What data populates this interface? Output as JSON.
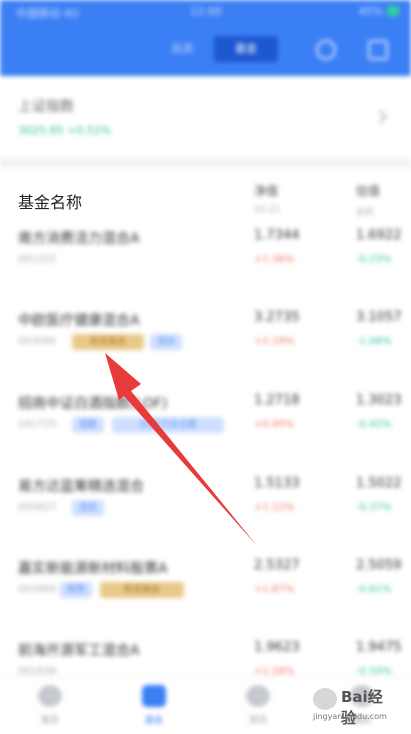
{
  "status_bar": {
    "left": "中国移动 4G",
    "time": "12:00",
    "right": "45%"
  },
  "header": {
    "tabs": [
      {
        "label": "自选"
      },
      {
        "label": "基金"
      }
    ],
    "search_icon": "search-icon",
    "menu_icon": "menu-icon",
    "bg_color": "#3b7ff5"
  },
  "summary": {
    "title": "上证指数",
    "subtitle": "3025.85 +0.52%"
  },
  "list": {
    "column_title": "基金名称",
    "col_headers": [
      {
        "title": "净值",
        "sub": "02-21"
      },
      {
        "title": "估值",
        "sub": "实时"
      }
    ],
    "rows": [
      {
        "name": "南方消费活力混合A",
        "code": "001222",
        "tags": [],
        "value1": "1.7344",
        "change1": "+1.36%",
        "value2": "1.6922",
        "change2": "-0.23%"
      },
      {
        "name": "中欧医疗健康混合A",
        "code": "003095",
        "tags": [
          {
            "label": "新发基金",
            "kind": "gold"
          },
          {
            "label": "混合",
            "kind": "blue"
          }
        ],
        "value1": "3.2735",
        "change1": "+2.19%",
        "value2": "3.1057",
        "change2": "-1.08%"
      },
      {
        "name": "招商中证白酒指数(LOF)",
        "code": "161725",
        "tags": [
          {
            "label": "指数",
            "kind": "blue"
          },
          {
            "label": "白酒 行业主题",
            "kind": "blue"
          }
        ],
        "value1": "1.2718",
        "change1": "+0.95%",
        "value2": "1.3023",
        "change2": "-0.42%"
      },
      {
        "name": "易方达蓝筹精选混合",
        "code": "005827",
        "tags": [
          {
            "label": "混合",
            "kind": "blue"
          }
        ],
        "value1": "1.5133",
        "change1": "+1.12%",
        "value2": "1.5022",
        "change2": "-0.37%"
      },
      {
        "name": "嘉实新能源新材料股票A",
        "code": "003984",
        "tags": [
          {
            "label": "新发基金",
            "kind": "gold"
          },
          {
            "label": "股票",
            "kind": "blue"
          }
        ],
        "value1": "2.5327",
        "change1": "+1.87%",
        "value2": "2.5059",
        "change2": "-0.61%"
      },
      {
        "name": "前海开源军工混合A",
        "code": "001838",
        "tags": [],
        "value1": "1.9623",
        "change1": "+1.28%",
        "value2": "1.9475",
        "change2": "-0.33%"
      }
    ]
  },
  "tabbar": {
    "items": [
      {
        "label": "首页"
      },
      {
        "label": "基金"
      },
      {
        "label": "资讯"
      },
      {
        "label": "我的"
      }
    ],
    "active": 1
  },
  "watermark": {
    "text": "Bai经验",
    "url": "jingyan.baidu.com"
  },
  "annotation": {
    "arrow_color": "#e83a3a"
  }
}
